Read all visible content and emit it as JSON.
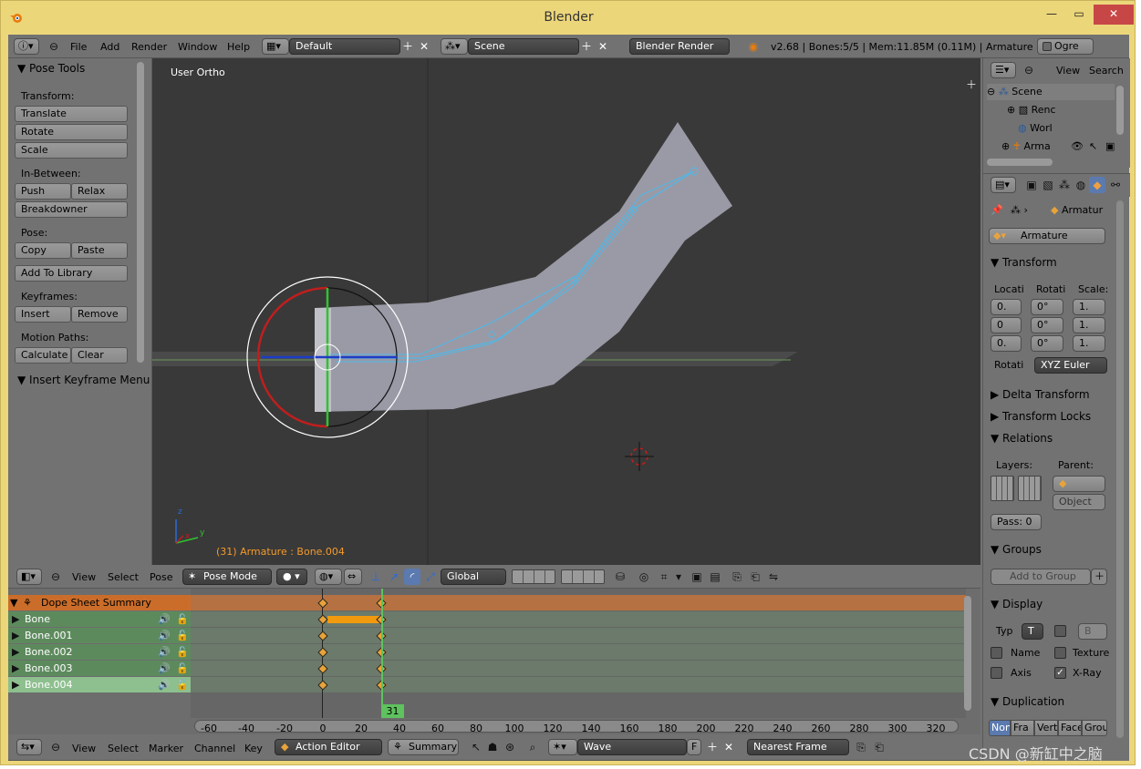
{
  "window": {
    "title": "Blender"
  },
  "topbar": {
    "menus": [
      "File",
      "Add",
      "Render",
      "Window",
      "Help"
    ],
    "layout": "Default",
    "scene": "Scene",
    "engine": "Blender Render",
    "stats": "v2.68 | Bones:5/5  | Mem:11.85M (0.11M) | Armature",
    "ogre": "Ogre"
  },
  "tools": {
    "title": "Pose Tools",
    "transform_label": "Transform:",
    "translate": "Translate",
    "rotate": "Rotate",
    "scale": "Scale",
    "inbetween_label": "In-Between:",
    "push": "Push",
    "relax": "Relax",
    "breakdowner": "Breakdowner",
    "pose_label": "Pose:",
    "copy": "Copy",
    "paste": "Paste",
    "add_library": "Add To Library",
    "keyframes_label": "Keyframes:",
    "insert": "Insert",
    "remove": "Remove",
    "motion_label": "Motion Paths:",
    "calculate": "Calculate",
    "clear": "Clear",
    "insert_keyframe_menu": "Insert Keyframe Menu"
  },
  "viewport": {
    "view_label": "User Ortho",
    "status": "(31) Armature : Bone.004",
    "axis_z": "z",
    "axis_x": "x",
    "axis_y": "y"
  },
  "view3d_header": {
    "menus": [
      "View",
      "Select",
      "Pose"
    ],
    "mode": "Pose Mode",
    "orientation": "Global"
  },
  "dopesheet": {
    "summary": "Dope Sheet Summary",
    "channels": [
      "Bone",
      "Bone.001",
      "Bone.002",
      "Bone.003",
      "Bone.004"
    ],
    "current_frame": "31",
    "ticks": [
      "-60",
      "-40",
      "-20",
      "0",
      "20",
      "40",
      "60",
      "80",
      "100",
      "120",
      "140",
      "160",
      "180",
      "200",
      "220",
      "240",
      "260",
      "280",
      "300",
      "320"
    ]
  },
  "timeline_header": {
    "menus": [
      "View",
      "Select",
      "Marker",
      "Channel",
      "Key"
    ],
    "editor": "Action Editor",
    "summary": "Summary",
    "action": "Wave",
    "f_label": "F",
    "snap": "Nearest Frame"
  },
  "outliner": {
    "menus": [
      "View",
      "Search"
    ],
    "scene": "Scene",
    "items": [
      "Renc",
      "Worl",
      "Arma"
    ]
  },
  "properties": {
    "object_path": "Armatur",
    "object_name": "Armature",
    "transform": "Transform",
    "loc_label": "Locati",
    "rot_label": "Rotati",
    "scale_label": "Scale:",
    "loc": [
      "0.",
      "0",
      "0."
    ],
    "rot": [
      "0°",
      "0°",
      "0°"
    ],
    "scl": [
      "1.",
      "1.",
      "1."
    ],
    "rot_mode_label": "Rotati",
    "rot_mode": "XYZ Euler",
    "delta": "Delta Transform",
    "locks": "Transform Locks",
    "relations": "Relations",
    "layers_label": "Layers:",
    "parent_label": "Parent:",
    "parent_type": "Object",
    "pass": "Pass: 0",
    "groups": "Groups",
    "add_group": "Add to Group",
    "display": "Display",
    "type_label": "Typ",
    "type_val": "T",
    "bounds_val": "B",
    "name": "Name",
    "texture": "Texture",
    "axis": "Axis",
    "xray": "X-Ray",
    "duplication": "Duplication",
    "dup_tabs": [
      "Non",
      "Fra",
      "Vert",
      "Face",
      "Grou"
    ]
  },
  "watermark": "CSDN @新缸中之脑"
}
